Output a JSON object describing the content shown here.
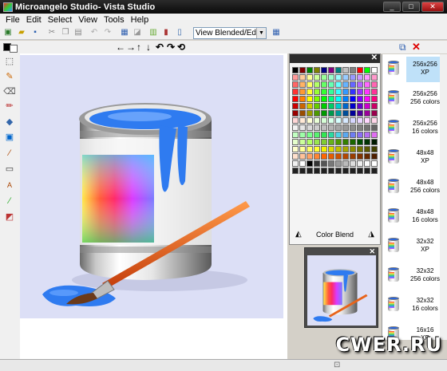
{
  "window": {
    "title": "Microangelo Studio- Vista Studio"
  },
  "window_controls": {
    "minimize": "_",
    "maximize": "□",
    "close": "✕"
  },
  "menu": [
    "File",
    "Edit",
    "Select",
    "View",
    "Tools",
    "Help"
  ],
  "toolbar": {
    "view_mode": "View Blended/Edit All"
  },
  "palette": {
    "label": "Color Blend",
    "colors": [
      "#000000",
      "#800000",
      "#008000",
      "#808000",
      "#000080",
      "#800080",
      "#008080",
      "#c0c0c0",
      "#808080",
      "#ff0000",
      "#00ff00",
      "#ffffff",
      "#ff9999",
      "#ffcc99",
      "#ffff99",
      "#ccff99",
      "#99ff99",
      "#99ffcc",
      "#99ffff",
      "#99ccff",
      "#9999ff",
      "#cc99ff",
      "#ff99ff",
      "#ff99cc",
      "#ff6666",
      "#ffb366",
      "#ffff66",
      "#b3ff66",
      "#66ff66",
      "#66ffb3",
      "#66ffff",
      "#66b3ff",
      "#6666ff",
      "#b366ff",
      "#ff66ff",
      "#ff66b3",
      "#ff3333",
      "#ff9933",
      "#ffff33",
      "#99ff33",
      "#33ff33",
      "#33ff99",
      "#33ffff",
      "#3399ff",
      "#3333ff",
      "#9933ff",
      "#ff33ff",
      "#ff3399",
      "#ff0000",
      "#ff8000",
      "#ffff00",
      "#80ff00",
      "#00ff00",
      "#00ff80",
      "#00ffff",
      "#0080ff",
      "#0000ff",
      "#8000ff",
      "#ff00ff",
      "#ff0080",
      "#cc0000",
      "#cc6600",
      "#cccc00",
      "#66cc00",
      "#00cc00",
      "#00cc66",
      "#00cccc",
      "#0066cc",
      "#0000cc",
      "#6600cc",
      "#cc00cc",
      "#cc0066",
      "#990000",
      "#994d00",
      "#999900",
      "#4d9900",
      "#009900",
      "#00994d",
      "#009999",
      "#004d99",
      "#000099",
      "#4d0099",
      "#990099",
      "#99004d",
      "#ffd6d6",
      "#ffe9d6",
      "#ffffd6",
      "#e9ffd6",
      "#d6ffd6",
      "#d6ffe9",
      "#d6ffff",
      "#d6e9ff",
      "#d6d6ff",
      "#e9d6ff",
      "#ffd6ff",
      "#ffd6e9",
      "#f2f2f2",
      "#e6e6e6",
      "#d9d9d9",
      "#cccccc",
      "#bfbfbf",
      "#b3b3b3",
      "#a6a6a6",
      "#999999",
      "#8c8c8c",
      "#808080",
      "#737373",
      "#666666",
      "#c2ffc2",
      "#9effa8",
      "#7bff8c",
      "#57f26f",
      "#33e653",
      "#2bd9a0",
      "#4dd2e6",
      "#5aa8f0",
      "#6e7df2",
      "#8a6ef2",
      "#b36ef2",
      "#e06ef2",
      "#e6ffcc",
      "#ccff99",
      "#b3ff66",
      "#99e64d",
      "#80cc33",
      "#66b31a",
      "#4d9900",
      "#337f00",
      "#1a6600",
      "#004d00",
      "#003300",
      "#001a00",
      "#ffffcc",
      "#ffff99",
      "#ffff66",
      "#ffff33",
      "#f2f200",
      "#d9d900",
      "#bfbf00",
      "#a6a600",
      "#8c8c00",
      "#737300",
      "#595900",
      "#404000",
      "#ffe0cc",
      "#ffc299",
      "#ffa366",
      "#ff8533",
      "#ff6600",
      "#e65c00",
      "#cc5200",
      "#b34700",
      "#993d00",
      "#803300",
      "#662900",
      "#4d1f00",
      "#f0f0f0",
      "#ffffff",
      "#000000",
      "#333333",
      "#555555",
      "#777777",
      "#999999",
      "#bbbbbb",
      "#dddddd",
      "#eeeeee",
      "#fafafa",
      "#ffffff",
      "#202020",
      "#202020",
      "#202020",
      "#202020",
      "#202020",
      "#202020",
      "#202020",
      "#202020",
      "#202020",
      "#202020",
      "#202020",
      "#202020"
    ]
  },
  "icon_formats": [
    {
      "size": "256x256",
      "depth": "XP"
    },
    {
      "size": "256x256",
      "depth": "256 colors"
    },
    {
      "size": "256x256",
      "depth": "16 colors"
    },
    {
      "size": "48x48",
      "depth": "XP"
    },
    {
      "size": "48x48",
      "depth": "256 colors"
    },
    {
      "size": "48x48",
      "depth": "16 colors"
    },
    {
      "size": "32x32",
      "depth": "XP"
    },
    {
      "size": "32x32",
      "depth": "256 colors"
    },
    {
      "size": "32x32",
      "depth": "16 colors"
    },
    {
      "size": "16x16",
      "depth": "XP"
    }
  ],
  "selected_format": "256x256 XP",
  "watermark": "CWER.RU",
  "colors": {
    "accent_selection": "#bfe1f9",
    "canvas_bg": "#dcdff6",
    "paint_blue": "#2f7bf0",
    "brush_orange": "#e8631a"
  }
}
